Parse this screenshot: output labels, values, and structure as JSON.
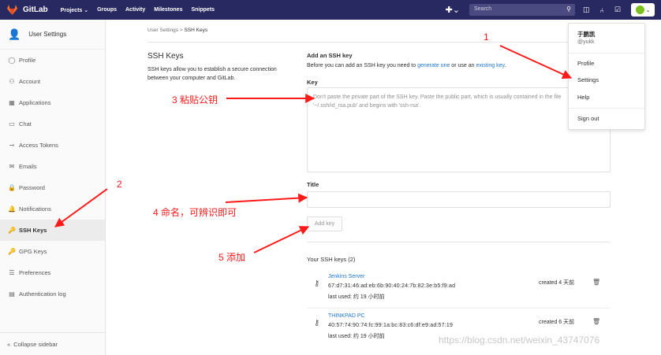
{
  "topbar": {
    "app_name": "GitLab",
    "nav": [
      "Projects ⌄",
      "Groups",
      "Activity",
      "Milestones",
      "Snippets"
    ],
    "plus": "✚⌄",
    "search_placeholder": "Search",
    "avatar_chevron": "⌄"
  },
  "sidebar": {
    "title": "User Settings",
    "items": [
      {
        "icon": "person-icon",
        "glyph": "◯",
        "label": "Profile"
      },
      {
        "icon": "account-icon",
        "glyph": "⚇",
        "label": "Account"
      },
      {
        "icon": "applications-icon",
        "glyph": "▦",
        "label": "Applications"
      },
      {
        "icon": "chat-icon",
        "glyph": "▭",
        "label": "Chat"
      },
      {
        "icon": "access-tokens-icon",
        "glyph": "⊸",
        "label": "Access Tokens"
      },
      {
        "icon": "emails-icon",
        "glyph": "✉",
        "label": "Emails"
      },
      {
        "icon": "password-icon",
        "glyph": "🔒",
        "label": "Password"
      },
      {
        "icon": "notifications-icon",
        "glyph": "🔔",
        "label": "Notifications"
      },
      {
        "icon": "ssh-keys-icon",
        "glyph": "🔑",
        "label": "SSH Keys"
      },
      {
        "icon": "gpg-keys-icon",
        "glyph": "🔑",
        "label": "GPG Keys"
      },
      {
        "icon": "preferences-icon",
        "glyph": "☰",
        "label": "Preferences"
      },
      {
        "icon": "authentication-log-icon",
        "glyph": "▤",
        "label": "Authentication log"
      }
    ],
    "collapse_label": "Collapse sidebar"
  },
  "breadcrumb": {
    "parent": "User Settings",
    "sep": ">",
    "current": "SSH Keys"
  },
  "section": {
    "title": "SSH Keys",
    "description": "SSH keys allow you to establish a secure connection between your computer and GitLab."
  },
  "form": {
    "title": "Add an SSH key",
    "desc_pre": "Before you can add an SSH key you need to ",
    "desc_link1": "generate one",
    "desc_mid": " or use an ",
    "desc_link2": "existing key",
    "desc_post": ".",
    "key_label": "Key",
    "key_placeholder": "Don't paste the private part of the SSH key. Paste the public part, which is usually contained in the file '~/.ssh/id_rsa.pub' and begins with 'ssh-rsa'.",
    "title_label": "Title",
    "title_value": "",
    "add_button": "Add key"
  },
  "keys": {
    "heading": "Your SSH keys (2)",
    "items": [
      {
        "name": "Jenkins Server",
        "fingerprint": "67:d7:31:46:ad:eb:6b:90:40:24:7b:82:3e:b5:f9:ad",
        "last_used": "last used: 约 19 小时前",
        "created": "created 4 天前"
      },
      {
        "name": "THINKPAD PC",
        "fingerprint": "40:57:74:90:74:fc:99:1a:bc:83:c6:df:e9:ad:57:19",
        "last_used": "last used: 约 19 小时前",
        "created": "created 6 天前"
      }
    ]
  },
  "dropdown": {
    "name": "于鹏凯",
    "username": "@yukk",
    "items": [
      "Profile",
      "Settings",
      "Help",
      "Sign out"
    ]
  },
  "annotations": {
    "n1": "1",
    "n2": "2",
    "n3": "3 粘贴公钥",
    "n4": "4 命名，可辨识即可",
    "n5": "5 添加",
    "color": "#ff1a1a"
  },
  "watermark": "https://blog.csdn.net/weixin_43747076"
}
